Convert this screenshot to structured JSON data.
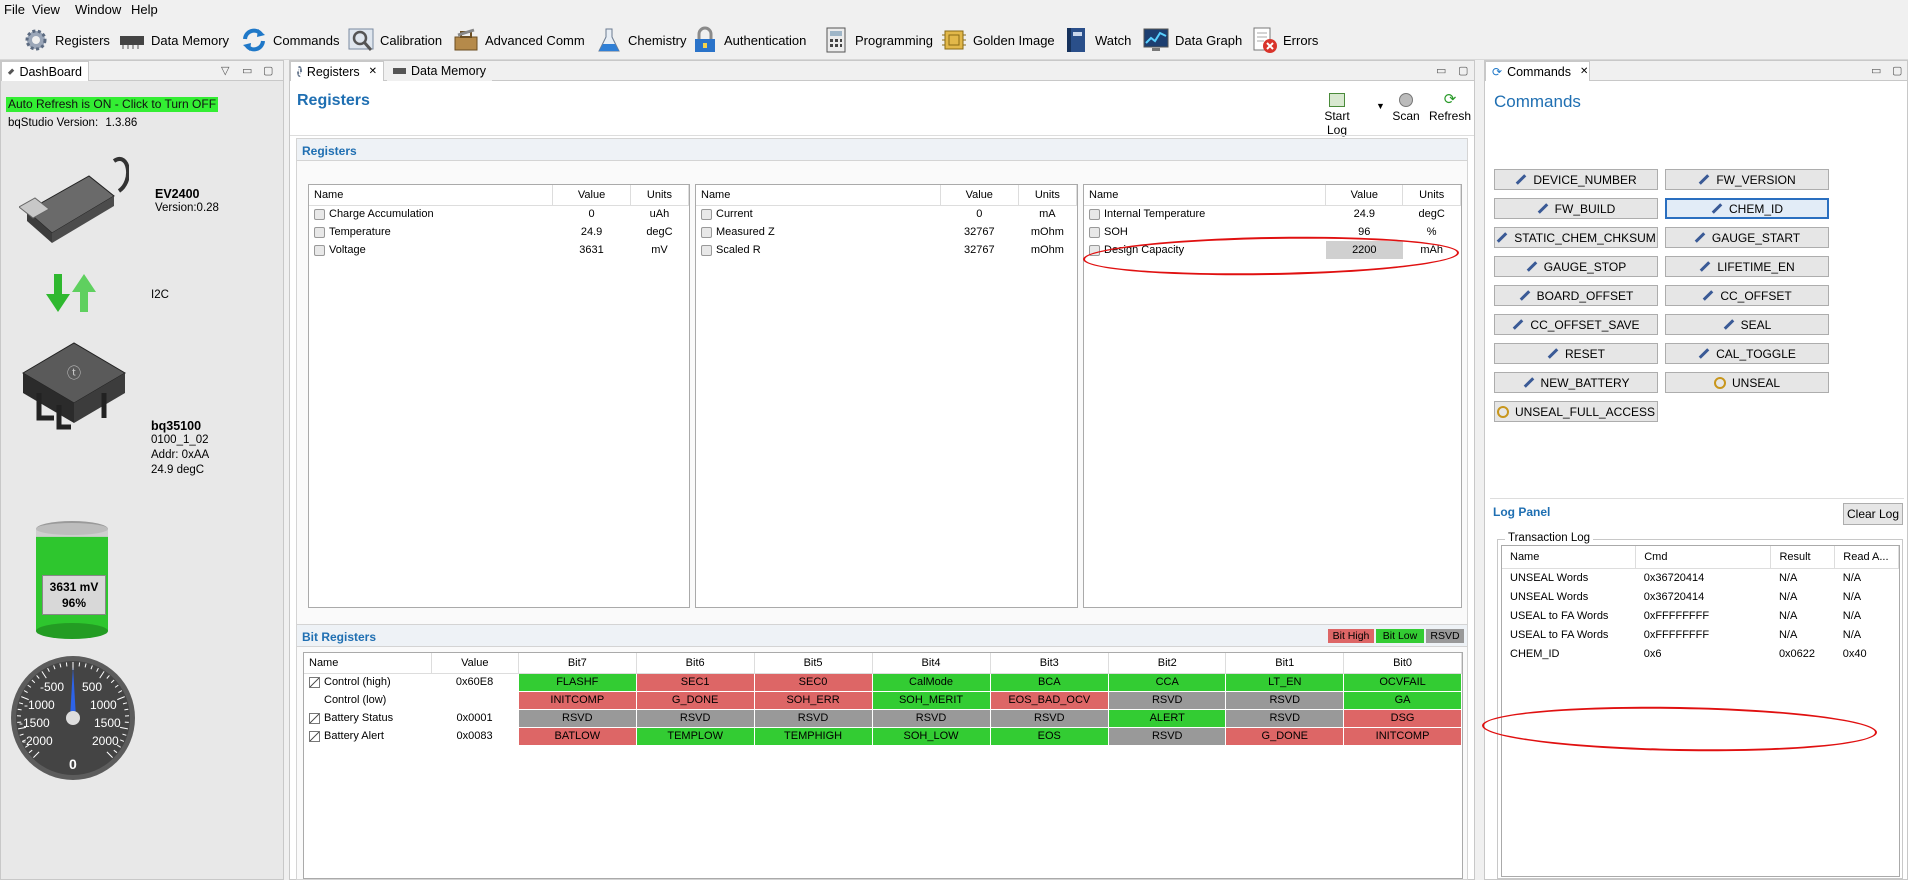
{
  "menu": [
    "File",
    "View",
    "Window",
    "Help"
  ],
  "toolbar": [
    "Registers",
    "Data Memory",
    "Commands",
    "Calibration",
    "Advanced Comm",
    "Chemistry",
    "Authentication",
    "Programming",
    "Golden Image",
    "Watch",
    "Data Graph",
    "Errors"
  ],
  "dashboard": {
    "tab": "DashBoard",
    "auto_refresh": "Auto Refresh is ON - Click to Turn OFF",
    "version_label": "bqStudio Version:",
    "version_value": "1.3.86",
    "adapter_name": "EV2400",
    "adapter_version": "Version:0.28",
    "bus": "I2C",
    "device_name": "bq35100",
    "device_fw": "0100_1_02",
    "device_addr": "Addr: 0xAA",
    "device_temp": "24.9 degC",
    "battery_mv": "3631 mV",
    "battery_pct": "96%",
    "battery_fill": 0.96,
    "gauge_labels": {
      "n500": "-500",
      "p500": "500",
      "n1000": "-1000",
      "p1000": "1000",
      "n1500": "-1500",
      "p1500": "1500",
      "n2000": "-2000",
      "p2000": "2000",
      "zero": "0"
    },
    "gauge_value": 0
  },
  "center": {
    "tabs": [
      "Registers",
      "Data Memory"
    ],
    "title": "Registers",
    "actions": {
      "start_log": "Start Log",
      "scan": "Scan",
      "refresh": "Refresh"
    },
    "section_registers": "Registers",
    "headers": {
      "name": "Name",
      "value": "Value",
      "units": "Units"
    },
    "table1": [
      {
        "name": "Charge Accumulation",
        "value": "0",
        "units": "uAh"
      },
      {
        "name": "Temperature",
        "value": "24.9",
        "units": "degC"
      },
      {
        "name": "Voltage",
        "value": "3631",
        "units": "mV"
      }
    ],
    "table2": [
      {
        "name": "Current",
        "value": "0",
        "units": "mA"
      },
      {
        "name": "Measured Z",
        "value": "32767",
        "units": "mOhm"
      },
      {
        "name": "Scaled R",
        "value": "32767",
        "units": "mOhm"
      }
    ],
    "table3": [
      {
        "name": "Internal Temperature",
        "value": "24.9",
        "units": "degC"
      },
      {
        "name": "SOH",
        "value": "96",
        "units": "%"
      },
      {
        "name": "Design Capacity",
        "value": "2200",
        "units": "mAh"
      }
    ],
    "bit_section": "Bit Registers",
    "legend": {
      "high": "Bit High",
      "low": "Bit Low",
      "rsvd": "RSVD"
    },
    "bit_headers": [
      "Name",
      "Value",
      "Bit7",
      "Bit6",
      "Bit5",
      "Bit4",
      "Bit3",
      "Bit2",
      "Bit1",
      "Bit0"
    ],
    "bit_rows": [
      {
        "name": "Control (high)",
        "value": "0x60E8",
        "bits": [
          [
            "FLASHF",
            "g"
          ],
          [
            "SEC1",
            "r"
          ],
          [
            "SEC0",
            "r"
          ],
          [
            "CalMode",
            "g"
          ],
          [
            "BCA",
            "g"
          ],
          [
            "CCA",
            "g"
          ],
          [
            "LT_EN",
            "g"
          ],
          [
            "OCVFAIL",
            "g"
          ]
        ]
      },
      {
        "name": "Control (low)",
        "value": "",
        "bits": [
          [
            "INITCOMP",
            "r"
          ],
          [
            "G_DONE",
            "r"
          ],
          [
            "SOH_ERR",
            "r"
          ],
          [
            "SOH_MERIT",
            "g"
          ],
          [
            "EOS_BAD_OCV",
            "r"
          ],
          [
            "RSVD",
            "x"
          ],
          [
            "RSVD",
            "x"
          ],
          [
            "GA",
            "g"
          ]
        ]
      },
      {
        "name": "Battery Status",
        "value": "0x0001",
        "bits": [
          [
            "RSVD",
            "x"
          ],
          [
            "RSVD",
            "x"
          ],
          [
            "RSVD",
            "x"
          ],
          [
            "RSVD",
            "x"
          ],
          [
            "RSVD",
            "x"
          ],
          [
            "ALERT",
            "g"
          ],
          [
            "RSVD",
            "x"
          ],
          [
            "DSG",
            "r"
          ]
        ]
      },
      {
        "name": "Battery Alert",
        "value": "0x0083",
        "bits": [
          [
            "BATLOW",
            "r"
          ],
          [
            "TEMPLOW",
            "g"
          ],
          [
            "TEMPHIGH",
            "g"
          ],
          [
            "SOH_LOW",
            "g"
          ],
          [
            "EOS",
            "g"
          ],
          [
            "RSVD",
            "x"
          ],
          [
            "G_DONE",
            "r"
          ],
          [
            "INITCOMP",
            "r"
          ]
        ]
      }
    ]
  },
  "commands": {
    "tab": "Commands",
    "title": "Commands",
    "buttons": [
      "DEVICE_NUMBER",
      "FW_VERSION",
      "FW_BUILD",
      "CHEM_ID",
      "STATIC_CHEM_CHKSUM",
      "GAUGE_START",
      "GAUGE_STOP",
      "LIFETIME_EN",
      "BOARD_OFFSET",
      "CC_OFFSET",
      "CC_OFFSET_SAVE",
      "SEAL",
      "RESET",
      "CAL_TOGGLE",
      "NEW_BATTERY",
      "UNSEAL",
      "UNSEAL_FULL_ACCESS"
    ],
    "log_panel": "Log Panel",
    "clear_log": "Clear Log",
    "transaction_log": "Transaction Log",
    "log_headers": [
      "Name",
      "Cmd",
      "Result",
      "Read A..."
    ],
    "log_rows": [
      [
        "UNSEAL Words",
        "0x36720414",
        "N/A",
        "N/A"
      ],
      [
        "UNSEAL Words",
        "0x36720414",
        "N/A",
        "N/A"
      ],
      [
        "USEAL to FA Words",
        "0xFFFFFFFF",
        "N/A",
        "N/A"
      ],
      [
        "USEAL to FA Words",
        "0xFFFFFFFF",
        "N/A",
        "N/A"
      ],
      [
        "CHEM_ID",
        "0x6",
        "0x0622",
        "0x40"
      ]
    ]
  },
  "colors": {
    "accent": "#1f6fb2",
    "bit_high": "#dd6666",
    "bit_low": "#33cc33",
    "rsvd": "#999999",
    "auto_refresh_bg": "#33ee33",
    "annotation": "#e01010"
  }
}
